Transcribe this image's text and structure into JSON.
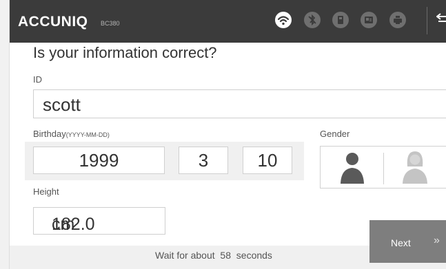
{
  "header": {
    "brand": "ACCUNIQ",
    "model": "BC380",
    "icons": [
      "wifi-icon",
      "bluetooth-off-icon",
      "device-icon",
      "id-card-icon",
      "printer-icon",
      "back-icon"
    ]
  },
  "form": {
    "title": "Is your information correct?",
    "id_label": "ID",
    "id_value": "scott",
    "birthday_label": "Birthday",
    "birthday_format": "(YYYY-MM-DD)",
    "birthday_year": "1999",
    "birthday_month": "3",
    "birthday_day": "10",
    "gender_label": "Gender",
    "height_label": "Height",
    "height_value": "182.0",
    "height_unit": "cm"
  },
  "footer": {
    "wait_prefix": "Wait for about",
    "wait_seconds": "58",
    "wait_suffix": "seconds",
    "next_label": "Next",
    "next_arrow": "»"
  },
  "colors": {
    "header_bg": "#3b3b3b",
    "gender_selected": "#5a5a5a",
    "gender_unselected": "#bdbdbd",
    "next_button": "#7e7e7e"
  }
}
